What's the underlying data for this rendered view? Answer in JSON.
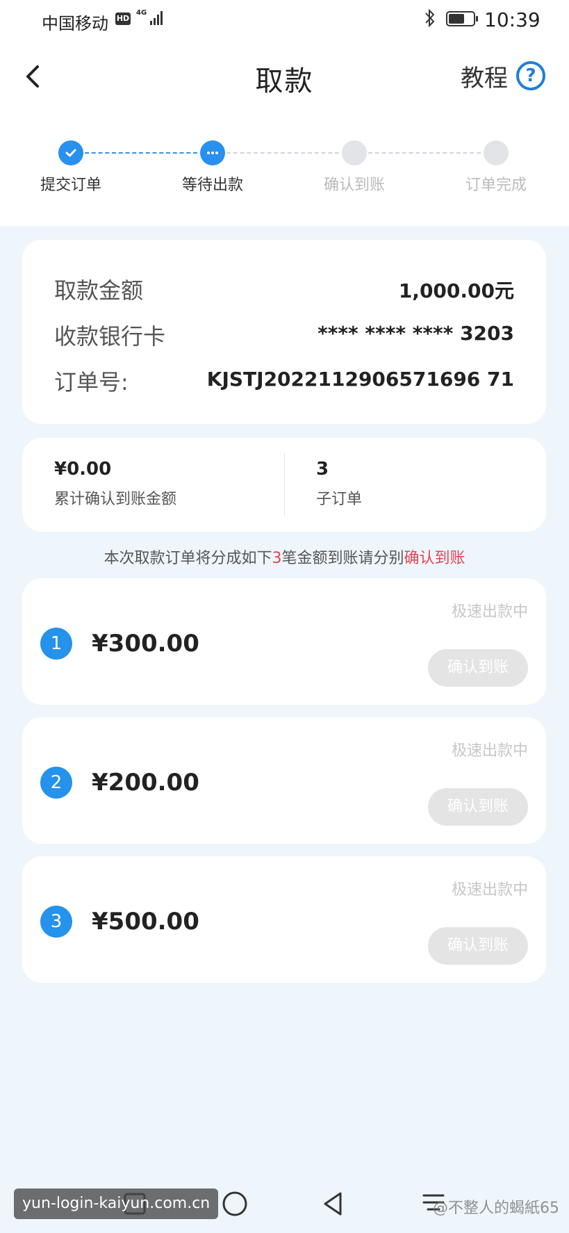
{
  "status_bar": {
    "carrier": "中国移动",
    "hd": "HD",
    "network": "4G",
    "time": "10:39"
  },
  "header": {
    "title": "取款",
    "tutorial_label": "教程",
    "help_glyph": "?"
  },
  "steps": [
    {
      "label": "提交订单",
      "state": "done"
    },
    {
      "label": "等待出款",
      "state": "current"
    },
    {
      "label": "确认到账",
      "state": "pending"
    },
    {
      "label": "订单完成",
      "state": "pending"
    }
  ],
  "order_info": {
    "amount_label": "取款金额",
    "amount_value": "1,000.00元",
    "card_label": "收款银行卡",
    "card_value": "**** **** **** 3203",
    "order_label": "订单号:",
    "order_value": "KJSTJ2022112906571696 71"
  },
  "summary": {
    "confirmed_value": "¥0.00",
    "confirmed_label": "累计确认到账金额",
    "suborders_value": "3",
    "suborders_label": "子订单"
  },
  "notice": {
    "prefix": "本次取款订单将分成如下",
    "count": "3",
    "middle": "笔金额到账请分别",
    "action": "确认到账"
  },
  "suborders": [
    {
      "index": "1",
      "amount": "¥300.00",
      "status": "极速出款中",
      "button": "确认到账"
    },
    {
      "index": "2",
      "amount": "¥200.00",
      "status": "极速出款中",
      "button": "确认到账"
    },
    {
      "index": "3",
      "amount": "¥500.00",
      "status": "极速出款中",
      "button": "确认到账"
    }
  ],
  "watermarks": {
    "site": "yun-login-kaiyun.com.cn",
    "user": "@不整人的蝎紙65"
  },
  "colors": {
    "accent": "#2890ee",
    "highlight": "#e24454",
    "background": "#eef5fb"
  }
}
